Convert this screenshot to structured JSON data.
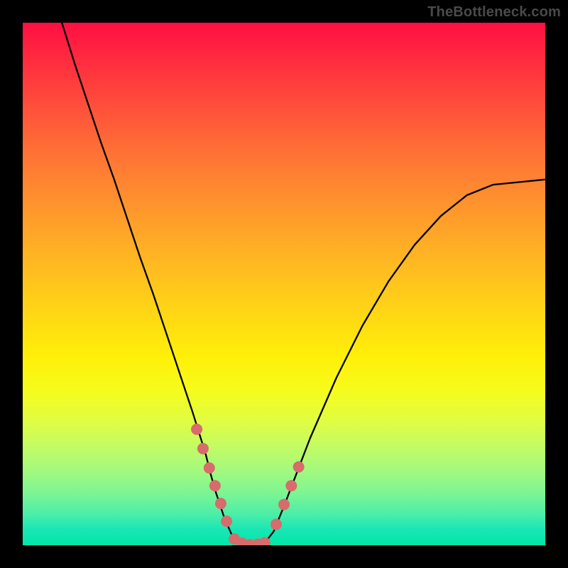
{
  "watermark": "TheBottleneck.com",
  "chart_data": {
    "type": "line",
    "title": "",
    "xlabel": "",
    "ylabel": "",
    "xlim": [
      0,
      100
    ],
    "ylim": [
      0,
      100
    ],
    "note": "Axes are implicit (no tick labels shown). Values estimated from pixel positions; y is percentage height of the curve from the bottom of the gradient panel.",
    "series": [
      {
        "name": "curve",
        "x": [
          7.5,
          10,
          12.5,
          15,
          17.5,
          20,
          22.5,
          25,
          27.5,
          30,
          32.5,
          35,
          36,
          37,
          38.5,
          40,
          42.5,
          45,
          46.5,
          48,
          50,
          52.5,
          55,
          60,
          65,
          70,
          75,
          80,
          85,
          90,
          95,
          100
        ],
        "y": [
          100,
          92,
          84.5,
          77,
          70,
          62.5,
          55,
          48,
          40.5,
          33,
          25.5,
          17.5,
          13.5,
          10,
          5.5,
          2,
          0,
          0,
          0.7,
          2.6,
          7.5,
          14,
          20.5,
          32,
          42,
          50.5,
          57.5,
          63,
          67,
          69,
          69.5,
          70
        ],
        "stroke": "#000000",
        "stroke_width": 2.3
      }
    ],
    "markers": [
      {
        "name": "left-cluster",
        "color": "#d86b6b",
        "points": [
          {
            "x": 33.3,
            "y": 22.2
          },
          {
            "x": 34.5,
            "y": 18.5
          },
          {
            "x": 35.7,
            "y": 14.8
          },
          {
            "x": 36.8,
            "y": 11.4
          },
          {
            "x": 37.9,
            "y": 8.0
          },
          {
            "x": 39.0,
            "y": 4.6
          }
        ],
        "radius": 8
      },
      {
        "name": "bottom-cluster",
        "color": "#d86b6b",
        "points": [
          {
            "x": 40.5,
            "y": 1.2
          },
          {
            "x": 42.0,
            "y": 0.4
          },
          {
            "x": 43.5,
            "y": 0.1
          },
          {
            "x": 45.0,
            "y": 0.2
          },
          {
            "x": 46.3,
            "y": 0.5
          }
        ],
        "radius": 8
      },
      {
        "name": "right-cluster",
        "color": "#d86b6b",
        "points": [
          {
            "x": 48.5,
            "y": 4.0
          },
          {
            "x": 50.0,
            "y": 7.8
          },
          {
            "x": 51.4,
            "y": 11.4
          },
          {
            "x": 52.8,
            "y": 15.0
          }
        ],
        "radius": 8
      }
    ],
    "background_gradient": {
      "orientation": "vertical",
      "stops": [
        {
          "pos": 0.0,
          "color": "#ff0f43"
        },
        {
          "pos": 0.5,
          "color": "#ffd000"
        },
        {
          "pos": 0.8,
          "color": "#d8ff40"
        },
        {
          "pos": 1.0,
          "color": "#00e7a8"
        }
      ]
    }
  }
}
